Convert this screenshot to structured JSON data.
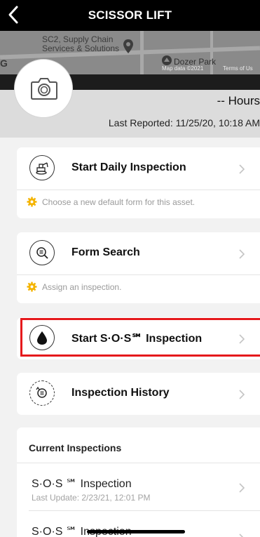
{
  "header": {
    "title": "SCISSOR LIFT"
  },
  "map": {
    "poi": "SC2, Supply Chain Services & Solutions",
    "park": "Dozer Park",
    "attribution": "Map data ©2021",
    "terms": "Terms of Us",
    "google_fragment": "G"
  },
  "asset": {
    "hours": "-- Hours",
    "last_reported": "Last Reported: 11/25/20, 10:18 AM"
  },
  "actions": {
    "daily": {
      "label": "Start Daily Inspection",
      "hint": "Choose a new default form for this asset."
    },
    "form_search": {
      "label": "Form Search",
      "hint": "Assign an inspection."
    },
    "sos": {
      "label": "Start S·O·S℠ Inspection"
    },
    "history": {
      "label": "Inspection History"
    }
  },
  "current_inspections": {
    "heading": "Current Inspections",
    "items": [
      {
        "title": "S·O·S ℠ Inspection",
        "subtitle": "Last Update: 2/23/21, 12:01 PM"
      },
      {
        "title": "S·O·S ℠ Inspection",
        "subtitle": ""
      }
    ]
  },
  "colors": {
    "highlight": "#e5191c",
    "gear": "#f4b400",
    "topbar": "#000000"
  }
}
